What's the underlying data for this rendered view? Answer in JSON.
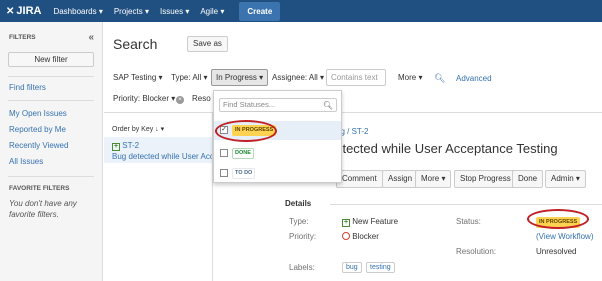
{
  "topnav": {
    "logo": "JIRA",
    "items": [
      "Dashboards ▾",
      "Projects ▾",
      "Issues ▾",
      "Agile ▾"
    ],
    "create": "Create"
  },
  "sidebar": {
    "heading": "FILTERS",
    "collapse": "«",
    "new_filter": "New filter",
    "find_filters": "Find filters",
    "links": [
      "My Open Issues",
      "Reported by Me",
      "Recently Viewed",
      "All Issues"
    ],
    "fav_heading": "FAVORITE FILTERS",
    "fav_note": "You don't have any favorite filters."
  },
  "search": {
    "title": "Search",
    "save_as": "Save as",
    "criteria": {
      "project": "SAP Testing ▾",
      "type": "Type: All ▾",
      "status": "In Progress ▾",
      "assignee": "Assignee: All ▾",
      "contains_placeholder": "Contains text",
      "more": "More ▾",
      "advanced": "Advanced"
    },
    "row2": {
      "priority": "Priority: Blocker ▾",
      "x": "×",
      "reso": "Reso"
    }
  },
  "status_dropdown": {
    "placeholder": "Find Statuses...",
    "options": [
      {
        "label": "IN PROGRESS",
        "checked": true
      },
      {
        "label": "DONE",
        "checked": false
      },
      {
        "label": "TO DO",
        "checked": false
      }
    ]
  },
  "list": {
    "order_by": "Order by Key ↓ ▾",
    "items": [
      {
        "key": "ST-2",
        "summary": "Bug detected while User Acceptance Testing"
      }
    ]
  },
  "issue": {
    "breadcrumb": "sting / ST-2",
    "title": "detected while User Acceptance Testing",
    "buttons": [
      "Comment",
      "Assign",
      "More ▾",
      "Stop Progress",
      "Done",
      "Admin ▾"
    ],
    "details_heading": "Details",
    "fields": {
      "type_label": "Type:",
      "type_value": "New Feature",
      "priority_label": "Priority:",
      "priority_value": "Blocker",
      "labels_label": "Labels:",
      "labels": [
        "bug",
        "testing"
      ],
      "status_label": "Status:",
      "status_value": "IN PROGRESS",
      "view_workflow": "(View Workflow)",
      "resolution_label": "Resolution:",
      "resolution_value": "Unresolved"
    }
  },
  "colors": {
    "topbar": "#205081",
    "link": "#3572b0",
    "in_progress": "#ffd351",
    "highlight_ring": "#c02026"
  }
}
